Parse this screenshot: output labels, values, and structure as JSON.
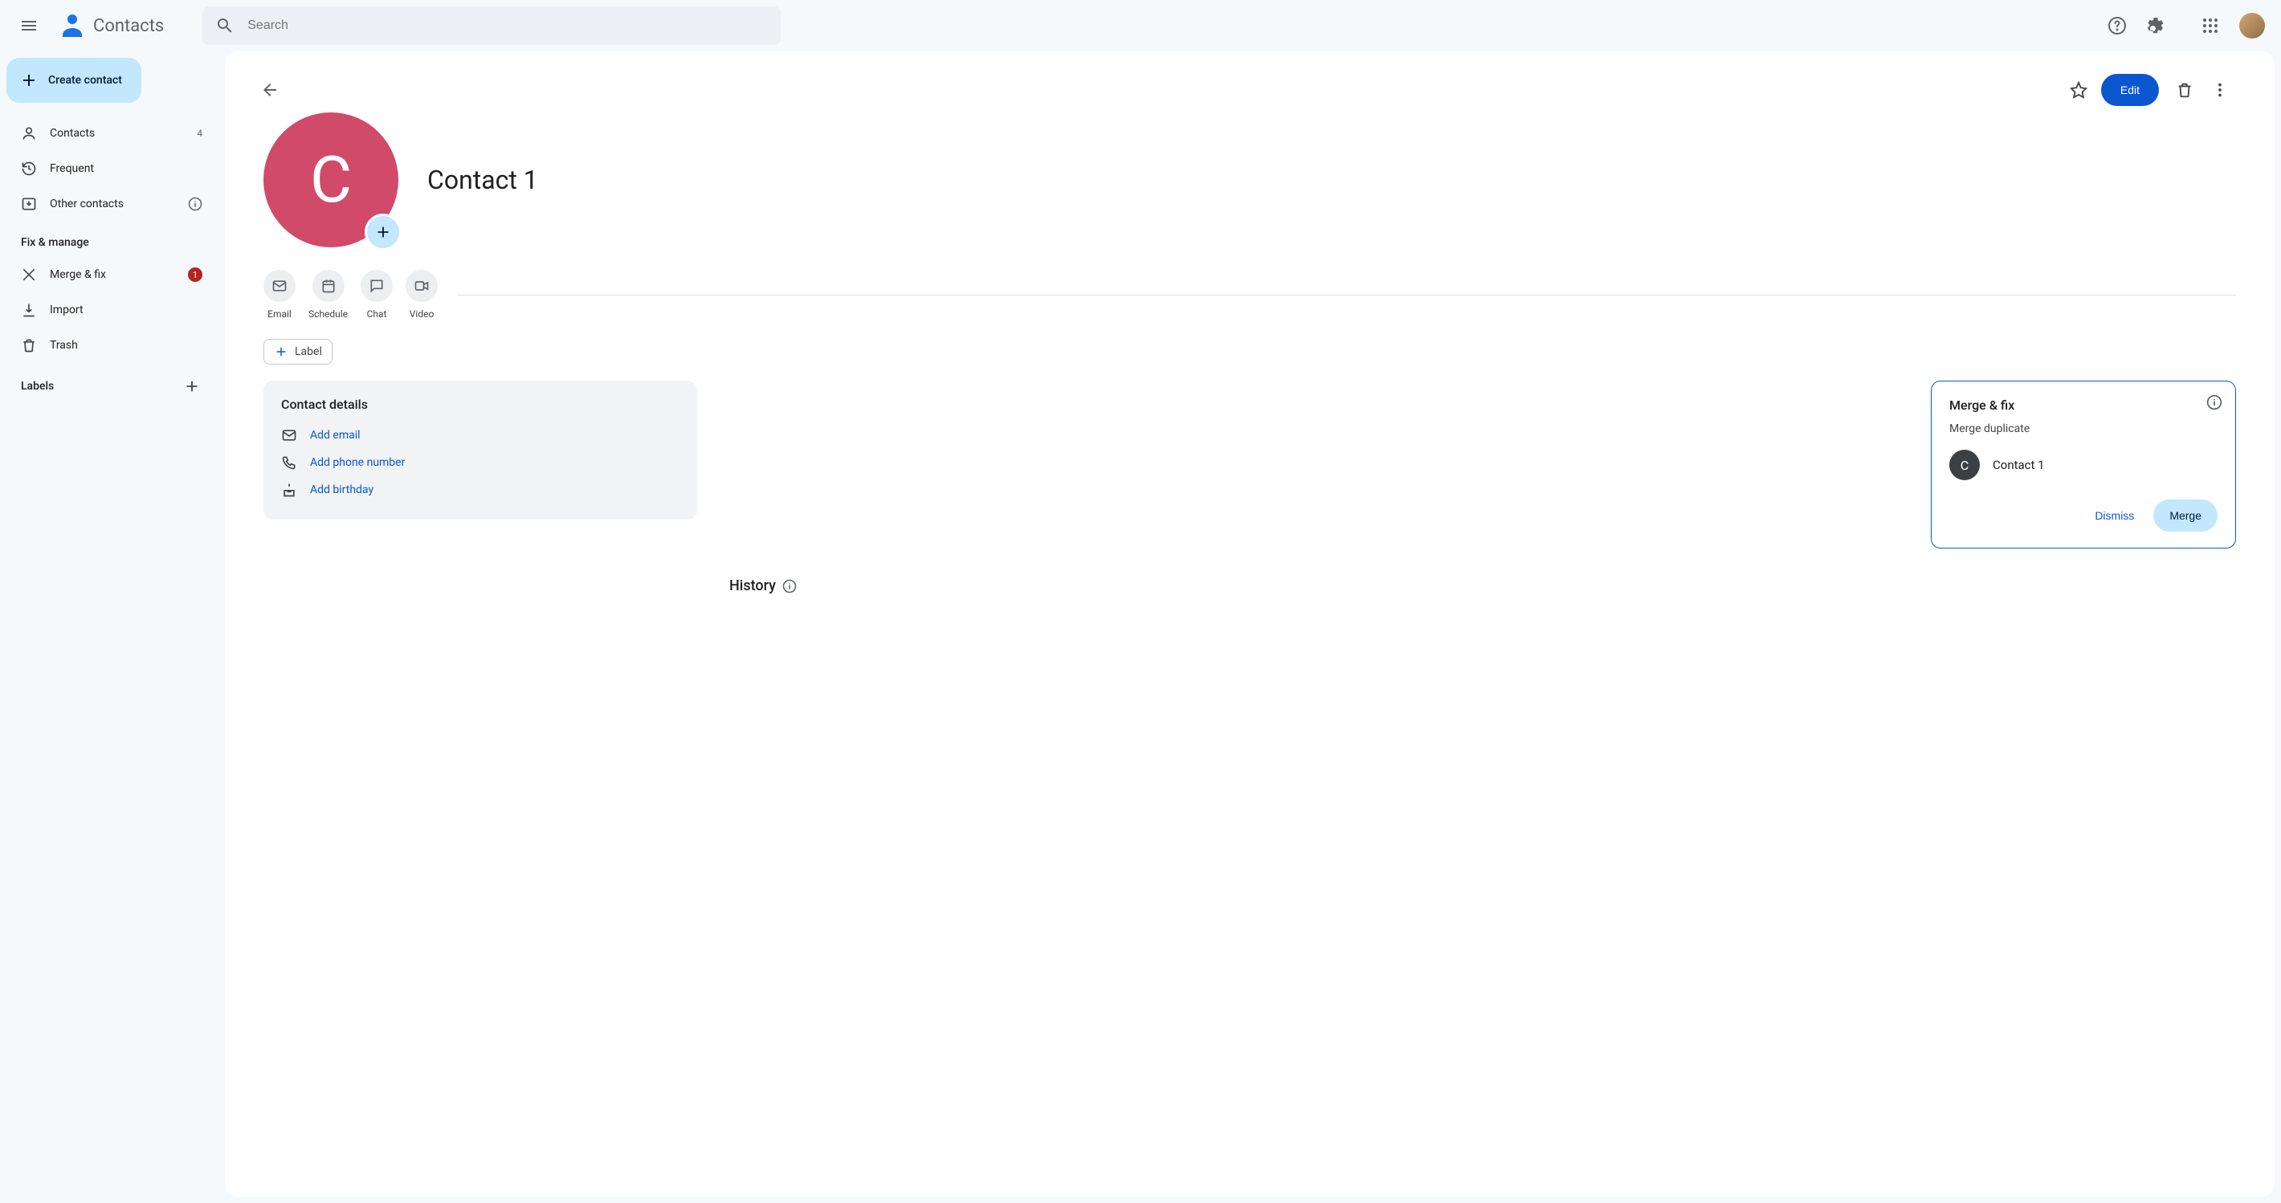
{
  "header": {
    "app_title": "Contacts",
    "search_placeholder": "Search"
  },
  "sidebar": {
    "create_label": "Create contact",
    "items": [
      {
        "label": "Contacts",
        "count": "4"
      },
      {
        "label": "Frequent"
      },
      {
        "label": "Other contacts"
      }
    ],
    "fix_section": "Fix & manage",
    "fix_items": [
      {
        "label": "Merge & fix",
        "badge": "1"
      },
      {
        "label": "Import"
      },
      {
        "label": "Trash"
      }
    ],
    "labels_section": "Labels"
  },
  "topbar": {
    "edit": "Edit"
  },
  "contact": {
    "name": "Contact 1",
    "initial": "C",
    "avatar_color": "#d14a6a"
  },
  "actions": {
    "email": "Email",
    "schedule": "Schedule",
    "chat": "Chat",
    "video": "Video"
  },
  "label_chip": "Label",
  "details": {
    "title": "Contact details",
    "add_email": "Add email",
    "add_phone": "Add phone number",
    "add_birthday": "Add birthday"
  },
  "merge": {
    "title": "Merge & fix",
    "subtitle": "Merge duplicate",
    "duplicate_name": "Contact 1",
    "duplicate_initial": "C",
    "dismiss": "Dismiss",
    "merge": "Merge"
  },
  "history": {
    "title": "History"
  }
}
